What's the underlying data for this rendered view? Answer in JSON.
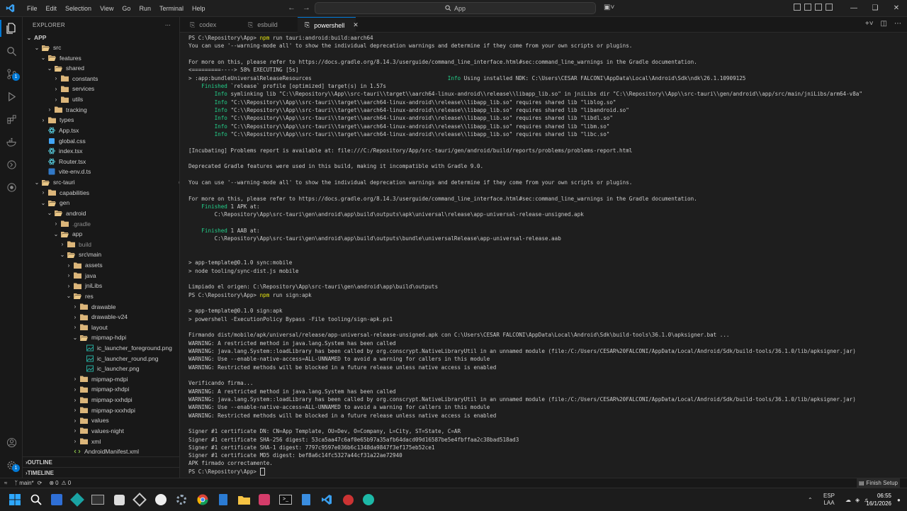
{
  "titlebar": {
    "menu": [
      "File",
      "Edit",
      "Selection",
      "View",
      "Go",
      "Run",
      "Terminal",
      "Help"
    ],
    "search": "App"
  },
  "activitybar": {
    "scm_badge": "1"
  },
  "explorer": {
    "header": "EXPLORER",
    "root": "APP",
    "tree": [
      {
        "label": "src",
        "indent": 1,
        "kind": "folder",
        "open": true,
        "dot": false
      },
      {
        "label": "features",
        "indent": 2,
        "kind": "folder",
        "open": true,
        "dot": false
      },
      {
        "label": "shared",
        "indent": 3,
        "kind": "folder",
        "open": true,
        "dot": false
      },
      {
        "label": "constants",
        "indent": 4,
        "kind": "folder",
        "open": false,
        "dot": false
      },
      {
        "label": "services",
        "indent": 4,
        "kind": "folder",
        "open": false,
        "dot": false
      },
      {
        "label": "utils",
        "indent": 4,
        "kind": "folder",
        "open": false,
        "dot": false
      },
      {
        "label": "tracking",
        "indent": 3,
        "kind": "folder",
        "open": false,
        "dot": false
      },
      {
        "label": "types",
        "indent": 2,
        "kind": "folder",
        "open": false,
        "dot": false
      },
      {
        "label": "App.tsx",
        "indent": 2,
        "kind": "tsx",
        "dot": false
      },
      {
        "label": "global.css",
        "indent": 2,
        "kind": "css",
        "dot": false
      },
      {
        "label": "index.tsx",
        "indent": 2,
        "kind": "tsx",
        "dot": false
      },
      {
        "label": "Router.tsx",
        "indent": 2,
        "kind": "tsx",
        "dot": false
      },
      {
        "label": "vite-env.d.ts",
        "indent": 2,
        "kind": "ts",
        "dot": false
      },
      {
        "label": "src-tauri",
        "indent": 1,
        "kind": "folder",
        "open": true,
        "dot": true
      },
      {
        "label": "capabilities",
        "indent": 2,
        "kind": "folder",
        "open": false,
        "dot": false
      },
      {
        "label": "gen",
        "indent": 2,
        "kind": "folder",
        "open": true,
        "dot": true
      },
      {
        "label": "android",
        "indent": 3,
        "kind": "folder",
        "open": true,
        "dot": true
      },
      {
        "label": ".gradle",
        "indent": 4,
        "kind": "folder",
        "open": false,
        "dot": false,
        "dim": true
      },
      {
        "label": "app",
        "indent": 4,
        "kind": "folder",
        "open": true,
        "dot": true
      },
      {
        "label": "build",
        "indent": 5,
        "kind": "folder",
        "open": false,
        "dot": false,
        "dim": true
      },
      {
        "label": "src\\main",
        "indent": 5,
        "kind": "folder",
        "open": true,
        "dot": true
      },
      {
        "label": "assets",
        "indent": 6,
        "kind": "folder",
        "open": false,
        "dot": false
      },
      {
        "label": "java",
        "indent": 6,
        "kind": "folder",
        "open": false,
        "dot": true
      },
      {
        "label": "jniLibs",
        "indent": 6,
        "kind": "folder",
        "open": false,
        "dot": false
      },
      {
        "label": "res",
        "indent": 6,
        "kind": "folder",
        "open": true,
        "dot": false
      },
      {
        "label": "drawable",
        "indent": 7,
        "kind": "folder",
        "open": false,
        "dot": false
      },
      {
        "label": "drawable-v24",
        "indent": 7,
        "kind": "folder",
        "open": false,
        "dot": false
      },
      {
        "label": "layout",
        "indent": 7,
        "kind": "folder",
        "open": false,
        "dot": false
      },
      {
        "label": "mipmap-hdpi",
        "indent": 7,
        "kind": "folder",
        "open": true,
        "dot": false
      },
      {
        "label": "ic_launcher_foreground.png",
        "indent": 8,
        "kind": "png",
        "dot": false
      },
      {
        "label": "ic_launcher_round.png",
        "indent": 8,
        "kind": "png",
        "dot": false
      },
      {
        "label": "ic_launcher.png",
        "indent": 8,
        "kind": "png",
        "dot": false
      },
      {
        "label": "mipmap-mdpi",
        "indent": 7,
        "kind": "folder",
        "open": false,
        "dot": false
      },
      {
        "label": "mipmap-xhdpi",
        "indent": 7,
        "kind": "folder",
        "open": false,
        "dot": false
      },
      {
        "label": "mipmap-xxhdpi",
        "indent": 7,
        "kind": "folder",
        "open": false,
        "dot": false
      },
      {
        "label": "mipmap-xxxhdpi",
        "indent": 7,
        "kind": "folder",
        "open": false,
        "dot": false
      },
      {
        "label": "values",
        "indent": 7,
        "kind": "folder",
        "open": false,
        "dot": false
      },
      {
        "label": "values-night",
        "indent": 7,
        "kind": "folder",
        "open": false,
        "dot": false
      },
      {
        "label": "xml",
        "indent": 7,
        "kind": "folder",
        "open": false,
        "dot": false
      },
      {
        "label": "AndroidManifest.xml",
        "indent": 6,
        "kind": "xml",
        "dot": false
      }
    ],
    "outline": "OUTLINE",
    "timeline": "TIMELINE"
  },
  "tabs": [
    {
      "label": "codex",
      "active": false
    },
    {
      "label": "esbuild",
      "active": false
    },
    {
      "label": "powershell",
      "active": true
    }
  ],
  "terminal": {
    "lines": [
      [
        [
          "PS C:\\Repository\\App> ",
          ""
        ],
        [
          "npm",
          "cmd"
        ],
        [
          " run tauri:android:build:aarch64",
          ""
        ]
      ],
      [
        [
          "You can use '--warning-mode all' to show the individual deprecation warnings and determine if they come from your own scripts or plugins.",
          ""
        ]
      ],
      [
        [
          "",
          ""
        ]
      ],
      [
        [
          "For more on this, please refer to https://docs.gradle.org/8.14.3/userguide/command_line_interface.html#sec:command_line_warnings in the Gradle documentation.",
          ""
        ]
      ],
      [
        [
          "<=========----> 58% EXECUTING [5s]",
          ""
        ]
      ],
      [
        [
          "> :app:bundleUniversalReleaseResources                                          ",
          ""
        ],
        [
          "Info",
          "ok"
        ],
        [
          " Using installed NDK: C:\\Users\\CESAR FALCONI\\AppData\\Local\\Android\\Sdk\\ndk\\26.1.10909125",
          ""
        ]
      ],
      [
        [
          "    ",
          ""
        ],
        [
          "Finished",
          "ok"
        ],
        [
          " `release` profile [optimized] target(s) in 1.57s",
          ""
        ]
      ],
      [
        [
          "        ",
          ""
        ],
        [
          "Info",
          "ok"
        ],
        [
          " symlinking lib \"C:\\\\Repository\\\\App\\\\src-tauri\\\\target\\\\aarch64-linux-android\\\\release\\\\libapp_lib.so\" in jniLibs dir \"C:\\\\Repository\\\\App\\\\src-tauri\\\\gen/android\\\\app/src/main/jniLibs/arm64-v8a\"",
          ""
        ]
      ],
      [
        [
          "        ",
          ""
        ],
        [
          "Info",
          "ok"
        ],
        [
          " \"C:\\\\Repository\\\\App\\\\src-tauri\\\\target\\\\aarch64-linux-android\\\\release\\\\libapp_lib.so\" requires shared lib \"liblog.so\"",
          ""
        ]
      ],
      [
        [
          "        ",
          ""
        ],
        [
          "Info",
          "ok"
        ],
        [
          " \"C:\\\\Repository\\\\App\\\\src-tauri\\\\target\\\\aarch64-linux-android\\\\release\\\\libapp_lib.so\" requires shared lib \"libandroid.so\"",
          ""
        ]
      ],
      [
        [
          "        ",
          ""
        ],
        [
          "Info",
          "ok"
        ],
        [
          " \"C:\\\\Repository\\\\App\\\\src-tauri\\\\target\\\\aarch64-linux-android\\\\release\\\\libapp_lib.so\" requires shared lib \"libdl.so\"",
          ""
        ]
      ],
      [
        [
          "        ",
          ""
        ],
        [
          "Info",
          "ok"
        ],
        [
          " \"C:\\\\Repository\\\\App\\\\src-tauri\\\\target\\\\aarch64-linux-android\\\\release\\\\libapp_lib.so\" requires shared lib \"libm.so\"",
          ""
        ]
      ],
      [
        [
          "        ",
          ""
        ],
        [
          "Info",
          "ok"
        ],
        [
          " \"C:\\\\Repository\\\\App\\\\src-tauri\\\\target\\\\aarch64-linux-android\\\\release\\\\libapp_lib.so\" requires shared lib \"libc.so\"",
          ""
        ]
      ],
      [
        [
          "",
          ""
        ]
      ],
      [
        [
          "[Incubating] Problems report is available at: file:///C:/Repository/App/src-tauri/gen/android/build/reports/problems/problems-report.html",
          ""
        ]
      ],
      [
        [
          "",
          ""
        ]
      ],
      [
        [
          "Deprecated Gradle features were used in this build, making it incompatible with Gradle 9.0.",
          ""
        ]
      ],
      [
        [
          "",
          ""
        ]
      ],
      [
        [
          "You can use '--warning-mode all' to show the individual deprecation warnings and determine if they come from your own scripts or plugins.",
          ""
        ]
      ],
      [
        [
          "",
          ""
        ]
      ],
      [
        [
          "For more on this, please refer to https://docs.gradle.org/8.14.3/userguide/command_line_interface.html#sec:command_line_warnings in the Gradle documentation.",
          ""
        ]
      ],
      [
        [
          "    ",
          ""
        ],
        [
          "Finished",
          "ok"
        ],
        [
          " 1 APK at:",
          ""
        ]
      ],
      [
        [
          "        C:\\Repository\\App\\src-tauri\\gen\\android\\app\\build\\outputs\\apk\\universal\\release\\app-universal-release-unsigned.apk",
          ""
        ]
      ],
      [
        [
          "",
          ""
        ]
      ],
      [
        [
          "    ",
          ""
        ],
        [
          "Finished",
          "ok"
        ],
        [
          " 1 AAB at:",
          ""
        ]
      ],
      [
        [
          "        C:\\Repository\\App\\src-tauri\\gen\\android\\app\\build\\outputs\\bundle\\universalRelease\\app-universal-release.aab",
          ""
        ]
      ],
      [
        [
          "",
          ""
        ]
      ],
      [
        [
          "",
          ""
        ]
      ],
      [
        [
          "> app-template@0.1.0 sync:mobile",
          ""
        ]
      ],
      [
        [
          "> node tooling/sync-dist.js mobile",
          ""
        ]
      ],
      [
        [
          "",
          ""
        ]
      ],
      [
        [
          "Limpiado el origen: C:\\Repository\\App\\src-tauri\\gen\\android\\app\\build\\outputs",
          ""
        ]
      ],
      [
        [
          "PS C:\\Repository\\App> ",
          ""
        ],
        [
          "npm",
          "cmd"
        ],
        [
          " run sign:apk",
          ""
        ]
      ],
      [
        [
          "",
          ""
        ]
      ],
      [
        [
          "> app-template@0.1.0 sign:apk",
          ""
        ]
      ],
      [
        [
          "> powershell -ExecutionPolicy Bypass -File tooling/sign-apk.ps1",
          ""
        ]
      ],
      [
        [
          "",
          ""
        ]
      ],
      [
        [
          "Firmando dist/mobile/apk/universal/release/app-universal-release-unsigned.apk con C:\\Users\\CESAR FALCONI\\AppData\\Local\\Android\\Sdk\\build-tools\\36.1.0\\apksigner.bat ...",
          ""
        ]
      ],
      [
        [
          "WARNING: A restricted method in java.lang.System has been called",
          ""
        ]
      ],
      [
        [
          "WARNING: java.lang.System::loadLibrary has been called by org.conscrypt.NativeLibraryUtil in an unnamed module (file:/C:/Users/CESAR%20FALCONI/AppData/Local/Android/Sdk/build-tools/36.1.0/lib/apksigner.jar)",
          ""
        ]
      ],
      [
        [
          "WARNING: Use --enable-native-access=ALL-UNNAMED to avoid a warning for callers in this module",
          ""
        ]
      ],
      [
        [
          "WARNING: Restricted methods will be blocked in a future release unless native access is enabled",
          ""
        ]
      ],
      [
        [
          "",
          ""
        ]
      ],
      [
        [
          "Verificando firma...",
          ""
        ]
      ],
      [
        [
          "WARNING: A restricted method in java.lang.System has been called",
          ""
        ]
      ],
      [
        [
          "WARNING: java.lang.System::loadLibrary has been called by org.conscrypt.NativeLibraryUtil in an unnamed module (file:/C:/Users/CESAR%20FALCONI/AppData/Local/Android/Sdk/build-tools/36.1.0/lib/apksigner.jar)",
          ""
        ]
      ],
      [
        [
          "WARNING: Use --enable-native-access=ALL-UNNAMED to avoid a warning for callers in this module",
          ""
        ]
      ],
      [
        [
          "WARNING: Restricted methods will be blocked in a future release unless native access is enabled",
          ""
        ]
      ],
      [
        [
          "",
          ""
        ]
      ],
      [
        [
          "Signer #1 certificate DN: CN=App Template, OU=Dev, O=Company, L=City, ST=State, C=AR",
          ""
        ]
      ],
      [
        [
          "Signer #1 certificate SHA-256 digest: 53ca5aa47c6af0e65b97a35afb64dacd09d16587be5e4fbffaa2c38bad518ad3",
          ""
        ]
      ],
      [
        [
          "Signer #1 certificate SHA-1 digest: 7797c9597e036b6c1348da9847f3ef175eb52ce1",
          ""
        ]
      ],
      [
        [
          "Signer #1 certificate MD5 digest: bef8a6c14fc5327a44cf31a22ae72940",
          ""
        ]
      ],
      [
        [
          "APK firmado correctamente.",
          ""
        ]
      ],
      [
        [
          "PS C:\\Repository\\App> ",
          ""
        ]
      ]
    ]
  },
  "statusbar": {
    "branch": "main*",
    "errors": "0",
    "warnings": "0",
    "finish_setup": "Finish Setup"
  },
  "taskbar": {
    "lang": "ESP",
    "lang_sub": "LAA",
    "time": "06:55",
    "date": "16/1/2026"
  },
  "colors": {
    "accent": "#0078d4",
    "ok": "#23d18b",
    "cmd": "#e5e510"
  }
}
